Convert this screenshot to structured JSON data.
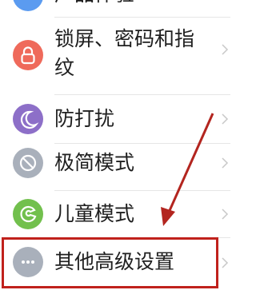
{
  "settings": {
    "items": [
      {
        "id": "top-partial",
        "label": "产品体验",
        "icon": "partial-icon",
        "color": "#5b9bf0"
      },
      {
        "id": "lock-screen",
        "label_line1": "锁屏、密码和指",
        "label_line2": "纹",
        "icon": "lock-icon",
        "color": "#ef6a5b"
      },
      {
        "id": "dnd",
        "label": "防打扰",
        "icon": "moon-icon",
        "color": "#8d6fc8"
      },
      {
        "id": "minimal",
        "label": "极简模式",
        "icon": "minimal-mode-icon",
        "color": "#a9b0bb"
      },
      {
        "id": "kids",
        "label": "儿童模式",
        "icon": "kids-mode-icon",
        "color": "#72c04d"
      },
      {
        "id": "advanced",
        "label": "其他高级设置",
        "icon": "more-dots-icon",
        "color": "#a9b0bb"
      }
    ]
  },
  "annotation": {
    "box_color": "#c0211c",
    "arrow_color": "#b3251f"
  }
}
